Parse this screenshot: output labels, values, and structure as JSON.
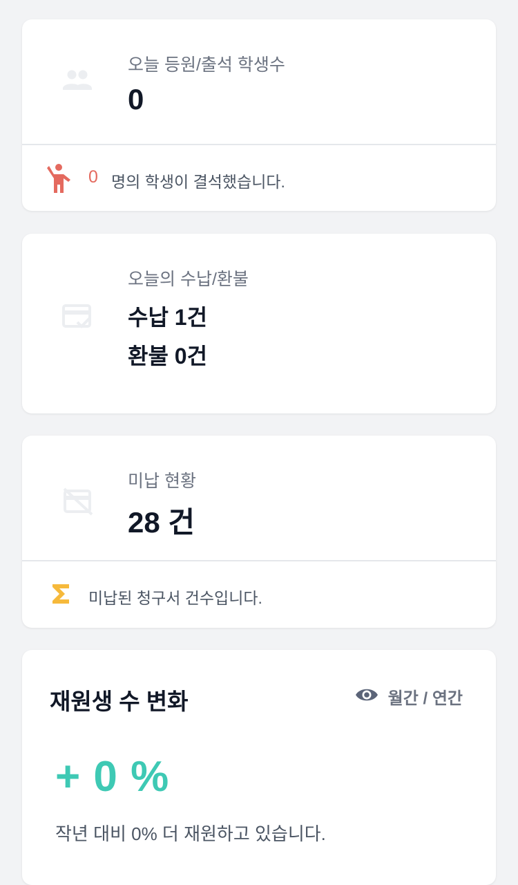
{
  "attendance": {
    "label": "오늘 등원/출석 학생수",
    "count": "0",
    "absent_count": "0",
    "absent_text": "명의 학생이 결석했습니다."
  },
  "payments": {
    "label": "오늘의 수납/환불",
    "paid_line": "수납 1건",
    "refund_line": "환불 0건"
  },
  "unpaid": {
    "label": "미납 현황",
    "value": "28 건",
    "note": "미납된 청구서 건수입니다."
  },
  "enrollment": {
    "title": "재원생 수 변화",
    "toggle_label": "월간 / 연간",
    "change": "+ 0 %",
    "comparison": "작년 대비 0% 더 재원하고 있습니다."
  },
  "colors": {
    "background": "#f2f3f5",
    "absent_accent": "#e46a5f",
    "sigma_accent": "#f6b93b",
    "change_accent": "#3ec9b4"
  }
}
